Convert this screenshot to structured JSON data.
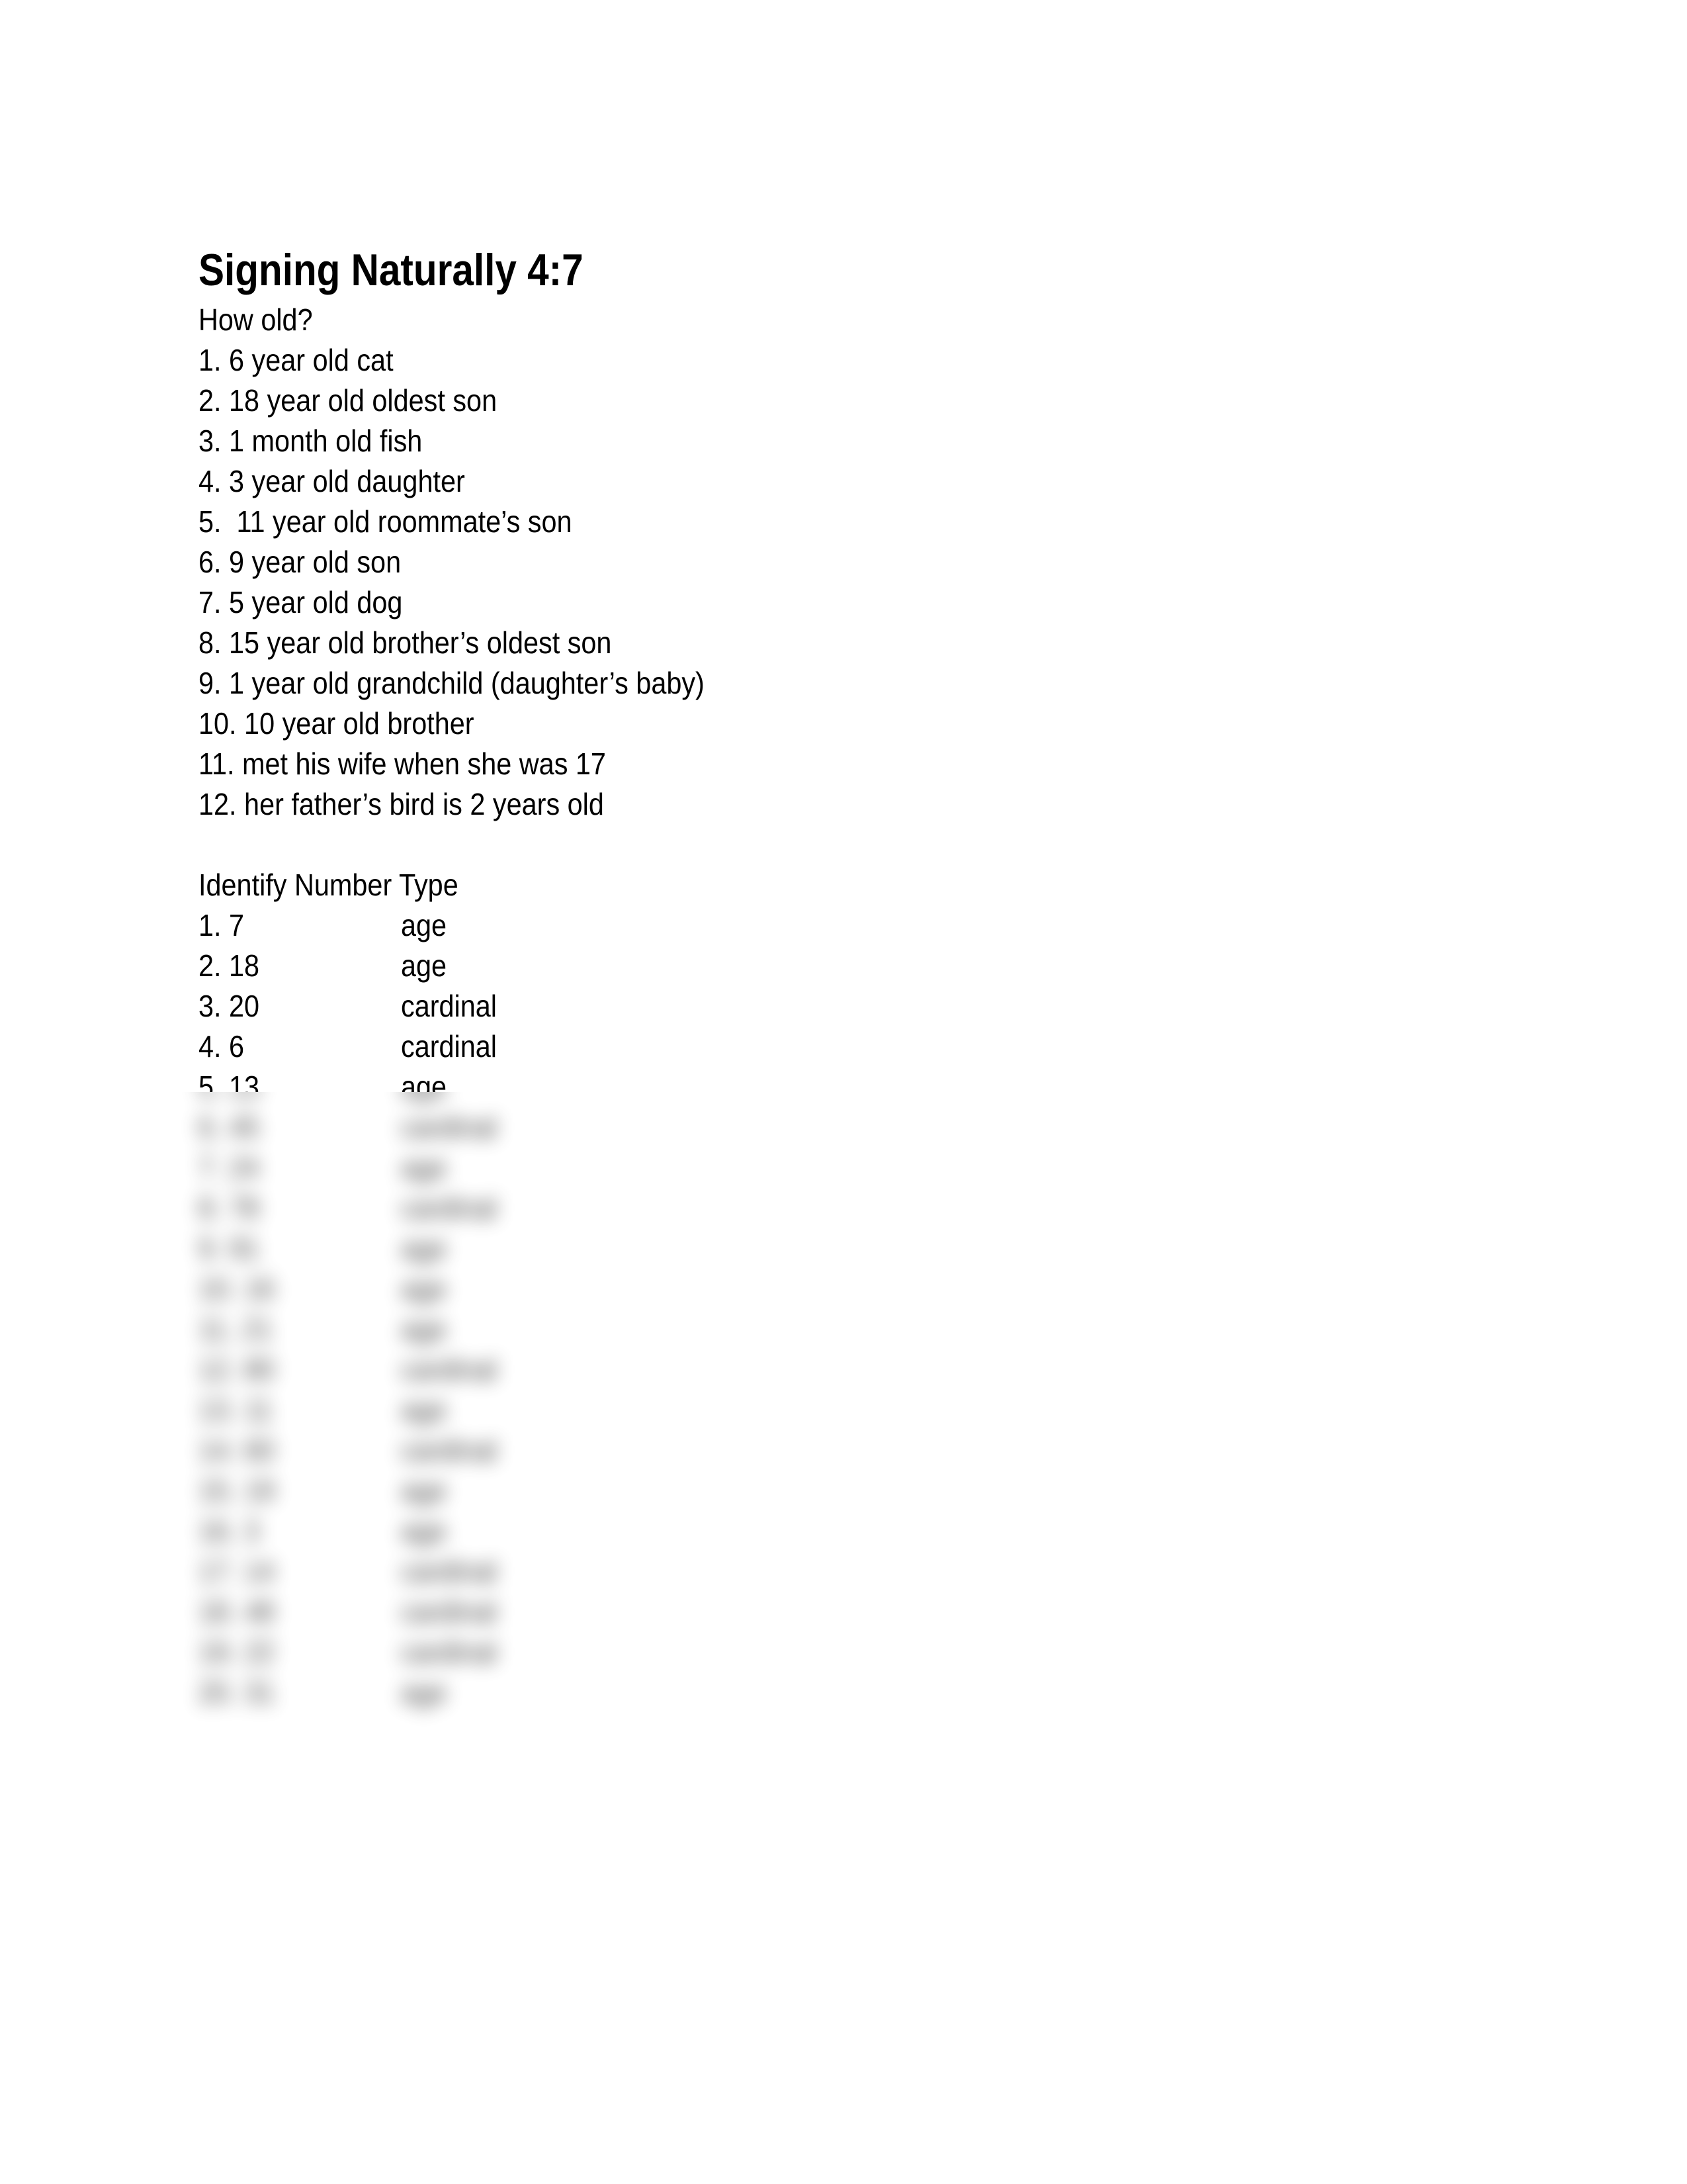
{
  "document": {
    "title": "Signing Naturally 4:7",
    "section1": {
      "heading": "How old?",
      "items": [
        "1. 6 year old cat",
        "2. 18 year old oldest son",
        "3. 1 month old fish",
        "4. 3 year old daughter",
        "5.  11 year old roommate’s son",
        "6. 9 year old son",
        "7. 5 year old dog",
        "8. 15 year old brother’s oldest son",
        "9. 1 year old grandchild (daughter’s baby)",
        "10. 10 year old brother",
        "11. met his wife when she was 17",
        "12. her father’s bird is 2 years old"
      ]
    },
    "section2": {
      "heading": "Identify Number Type",
      "rows": [
        {
          "num": "1. 7",
          "type": "age"
        },
        {
          "num": "2. 18",
          "type": "age"
        },
        {
          "num": "3. 20",
          "type": "cardinal"
        },
        {
          "num": "4. 6",
          "type": "cardinal"
        },
        {
          "num": "5. 13",
          "type": "age"
        },
        {
          "num": "6. 45",
          "type": "cardinal"
        },
        {
          "num": "7. 24",
          "type": "age"
        },
        {
          "num": "8. 78",
          "type": "cardinal"
        },
        {
          "num": "9. 91",
          "type": "age"
        },
        {
          "num": "10. 16",
          "type": "age"
        },
        {
          "num": "11. 21",
          "type": "age"
        },
        {
          "num": "12. 80",
          "type": "cardinal"
        },
        {
          "num": "13. 11",
          "type": "age"
        },
        {
          "num": "14. 60",
          "type": "cardinal"
        },
        {
          "num": "15. 19",
          "type": "age"
        },
        {
          "num": "16. 3",
          "type": "age"
        },
        {
          "num": "17. 14",
          "type": "cardinal"
        },
        {
          "num": "18. 48",
          "type": "cardinal"
        },
        {
          "num": "19. 22",
          "type": "cardinal"
        },
        {
          "num": "20. 31",
          "type": "age"
        }
      ],
      "blurred_from_row": 6
    }
  }
}
